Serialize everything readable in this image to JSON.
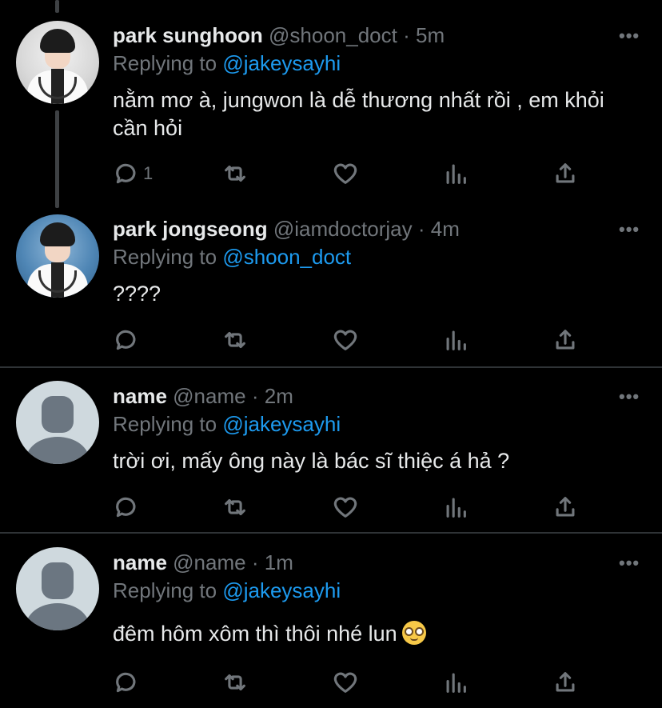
{
  "tweets": [
    {
      "name": "park sunghoon",
      "handle": "@shoon_doct",
      "time": "5m",
      "replying_prefix": "Replying to",
      "replying_to": "@jakeysayhi",
      "text": "nằm mơ à, jungwon là dễ thương nhất rồi , em khỏi cần hỏi",
      "reply_count": "1",
      "avatar": "photo"
    },
    {
      "name": "park jongseong",
      "handle": "@iamdoctorjay",
      "time": "4m",
      "replying_prefix": "Replying to",
      "replying_to": "@shoon_doct",
      "text": "????",
      "reply_count": "",
      "avatar": "photo"
    },
    {
      "name": "name",
      "handle": "@name",
      "time": "2m",
      "replying_prefix": "Replying to",
      "replying_to": "@jakeysayhi",
      "text": "trời ơi, mấy ông này là bác sĩ thiệc á hả ?",
      "reply_count": "",
      "avatar": "default"
    },
    {
      "name": "name",
      "handle": "@name",
      "time": "1m",
      "replying_prefix": "Replying to",
      "replying_to": "@jakeysayhi",
      "text": "đêm hôm xôm thì thôi nhé lun",
      "reply_count": "",
      "avatar": "default",
      "emoji": "nerd-face-emoji"
    }
  ],
  "separator": "·",
  "more_label": "•••",
  "colors": {
    "background": "#000000",
    "text": "#e7e9ea",
    "secondary": "#71767b",
    "link": "#1d9bf0",
    "divider": "#2f3336"
  },
  "icons": [
    "reply-icon",
    "retweet-icon",
    "like-icon",
    "stats-icon",
    "share-icon"
  ]
}
